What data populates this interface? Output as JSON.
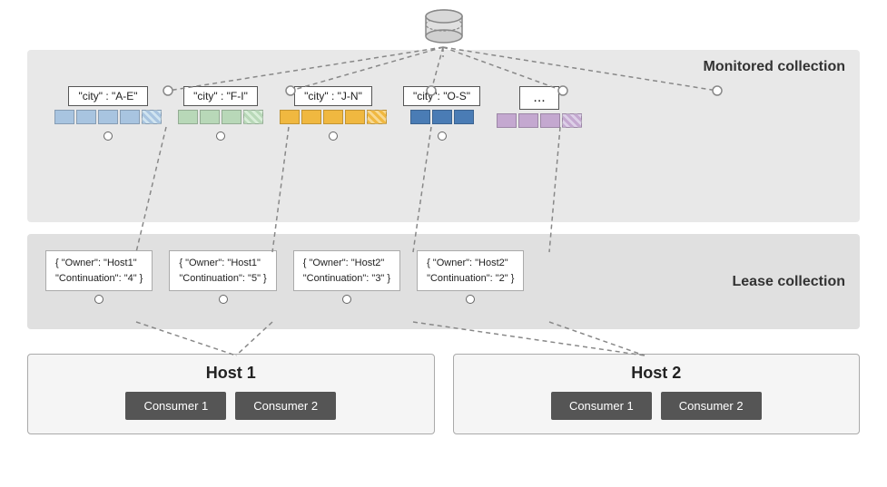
{
  "monitored": {
    "label": "Monitored collection",
    "partitions": [
      {
        "id": "p1",
        "label": "\"city\" : \"A-E\"",
        "blocks": [
          "blue",
          "blue",
          "blue",
          "blue",
          "hatched-blue"
        ],
        "color": "blue"
      },
      {
        "id": "p2",
        "label": "\"city\" : \"F-I\"",
        "blocks": [
          "green",
          "green",
          "green",
          "hatched-green"
        ],
        "color": "green"
      },
      {
        "id": "p3",
        "label": "\"city\" : \"J-N\"",
        "blocks": [
          "orange",
          "orange",
          "orange",
          "orange",
          "hatched-orange"
        ],
        "color": "orange"
      },
      {
        "id": "p4",
        "label": "\"city\": \"O-S\"",
        "blocks": [
          "dark-blue",
          "dark-blue",
          "dark-blue"
        ],
        "color": "dark-blue"
      },
      {
        "id": "p5",
        "label": "...",
        "blocks": [
          "purple",
          "purple",
          "purple",
          "hatched-purple"
        ],
        "color": "purple"
      }
    ]
  },
  "lease": {
    "label": "Lease collection",
    "items": [
      {
        "owner": "Host1",
        "continuation": "4"
      },
      {
        "owner": "Host1",
        "continuation": "5"
      },
      {
        "owner": "Host2",
        "continuation": "3"
      },
      {
        "owner": "Host2",
        "continuation": "2"
      }
    ]
  },
  "hosts": [
    {
      "title": "Host 1",
      "consumers": [
        "Consumer 1",
        "Consumer 2"
      ]
    },
    {
      "title": "Host 2",
      "consumers": [
        "Consumer 1",
        "Consumer 2"
      ]
    }
  ]
}
